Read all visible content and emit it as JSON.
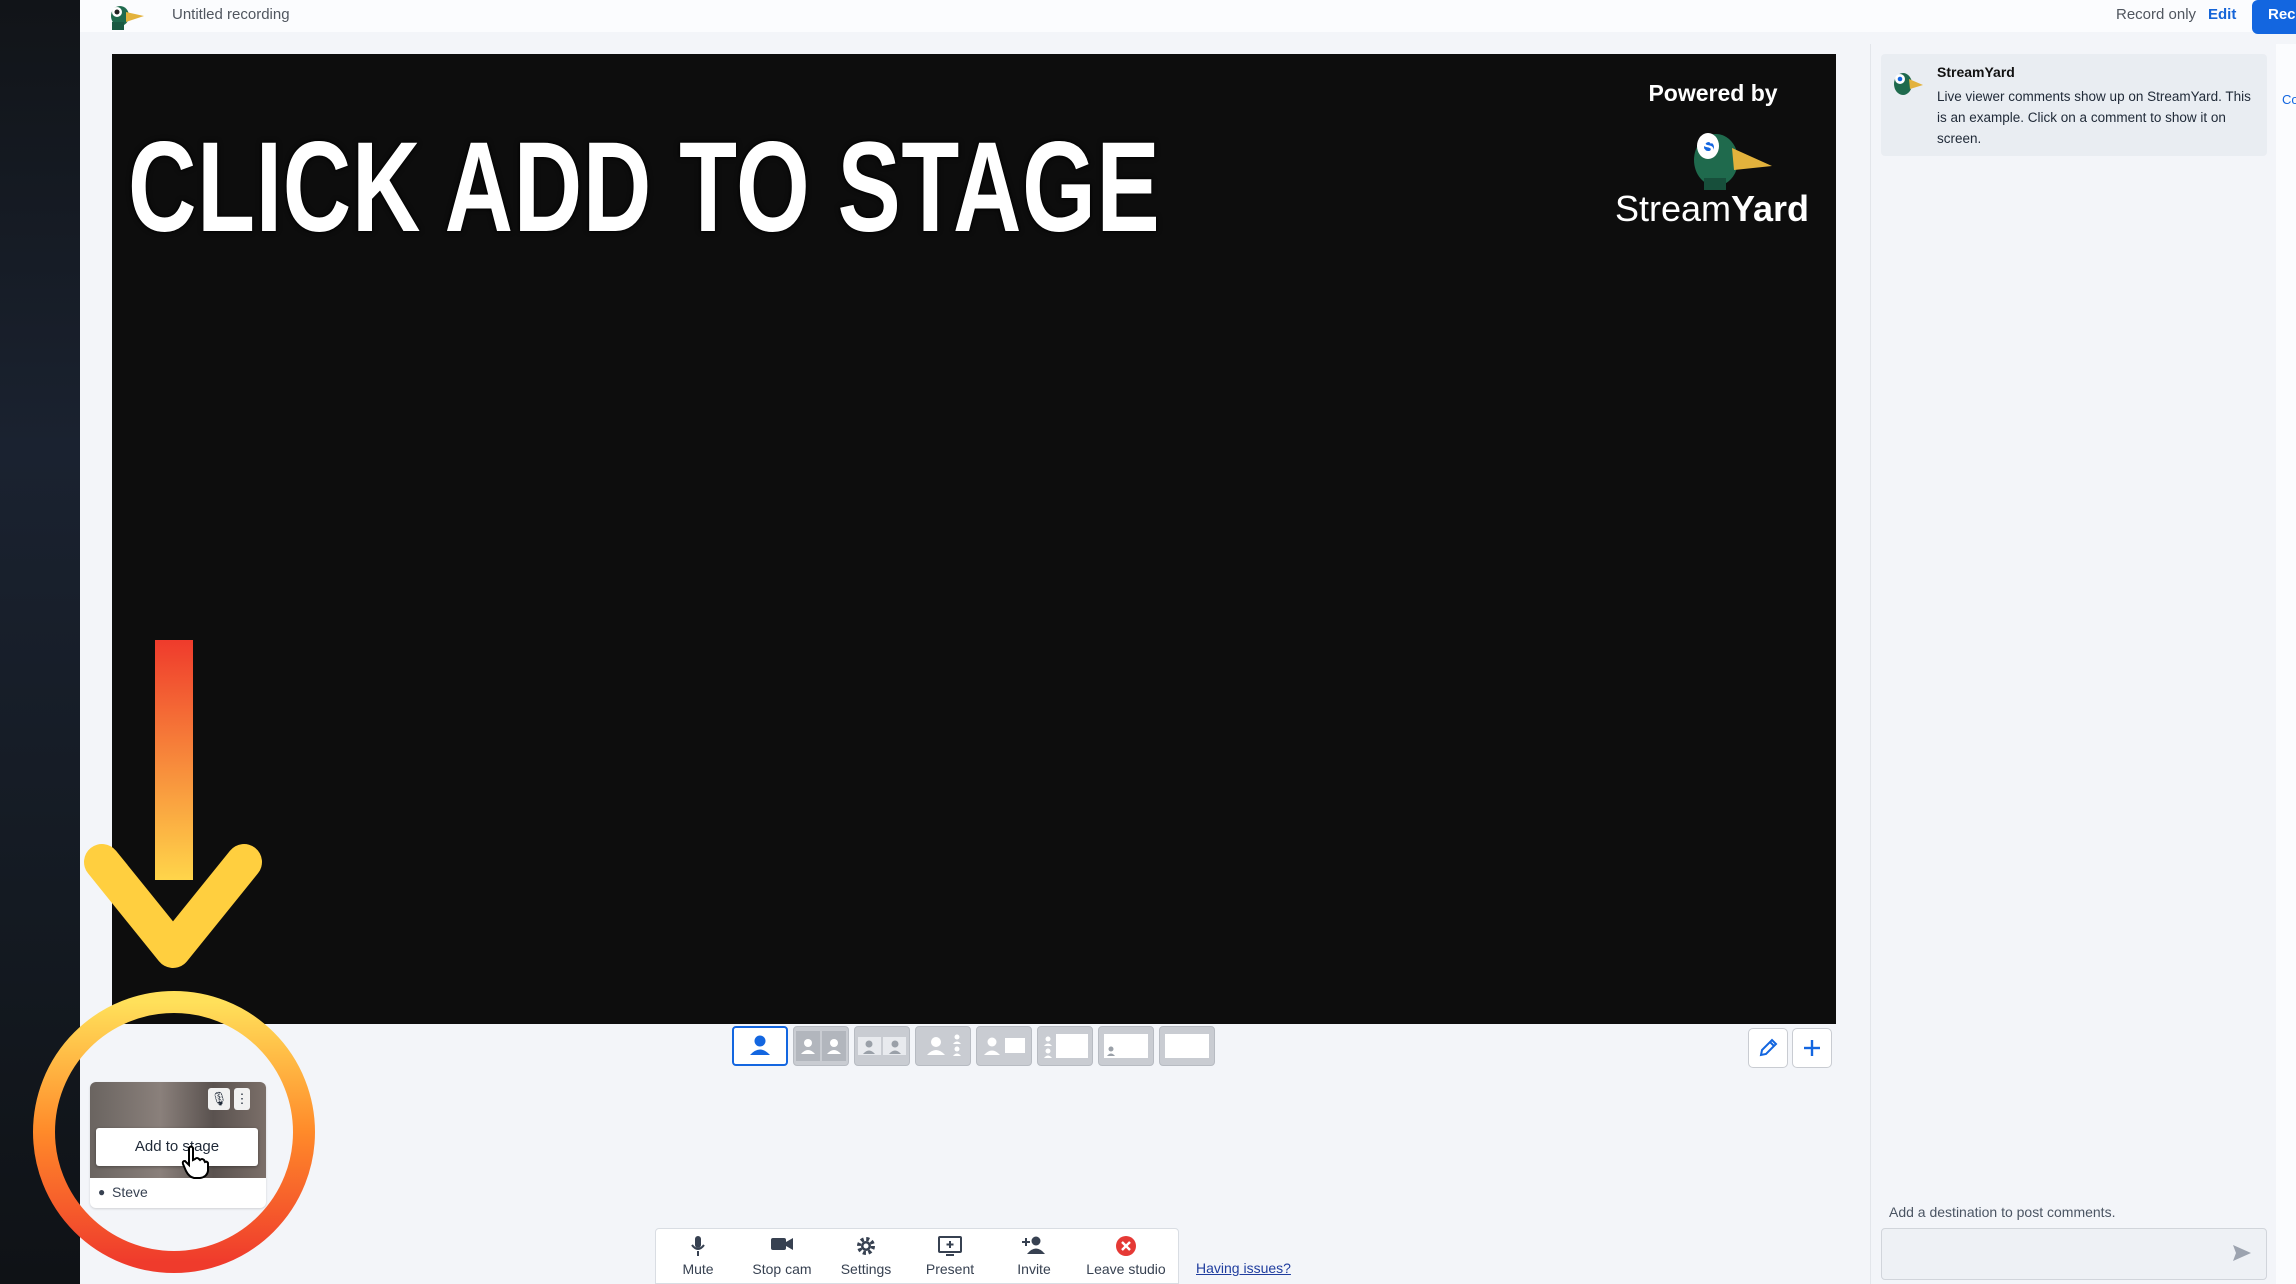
{
  "header": {
    "recording_title": "Untitled recording",
    "record_only": "Record only",
    "edit_label": "Edit",
    "record_button_label": "Rec"
  },
  "stage": {
    "overlay_title": "CLICK ADD TO STAGE",
    "powered_by": "Powered by",
    "brand_name_light": "Stream",
    "brand_name_bold": "Yard"
  },
  "layouts": [
    {
      "name": "solo"
    },
    {
      "name": "cropped"
    },
    {
      "name": "group"
    },
    {
      "name": "leader"
    },
    {
      "name": "screen-side"
    },
    {
      "name": "thin-screen"
    },
    {
      "name": "picture-in-picture"
    },
    {
      "name": "screen-only"
    }
  ],
  "participant": {
    "name": "Steve",
    "add_to_stage_label": "Add to stage"
  },
  "controls": [
    {
      "label": "Mute",
      "icon": "mic-icon"
    },
    {
      "label": "Stop cam",
      "icon": "camera-icon"
    },
    {
      "label": "Settings",
      "icon": "gear-icon"
    },
    {
      "label": "Present",
      "icon": "present-icon"
    },
    {
      "label": "Invite",
      "icon": "add-person-icon"
    },
    {
      "label": "Leave studio",
      "icon": "close-circle-icon"
    }
  ],
  "having_issues": "Having issues?",
  "comments": {
    "author": "StreamYard",
    "message": "Live viewer comments show up on StreamYard. This is an example. Click on a comment to show it on screen.",
    "destination_prompt": "Add a destination to post comments."
  },
  "edge_tab_label": "Co",
  "colors": {
    "accent": "#1366e0",
    "leave_red": "#e53935",
    "annotation_arrow_top": "#ef3b2c",
    "annotation_arrow_bottom": "#ffd54a"
  }
}
